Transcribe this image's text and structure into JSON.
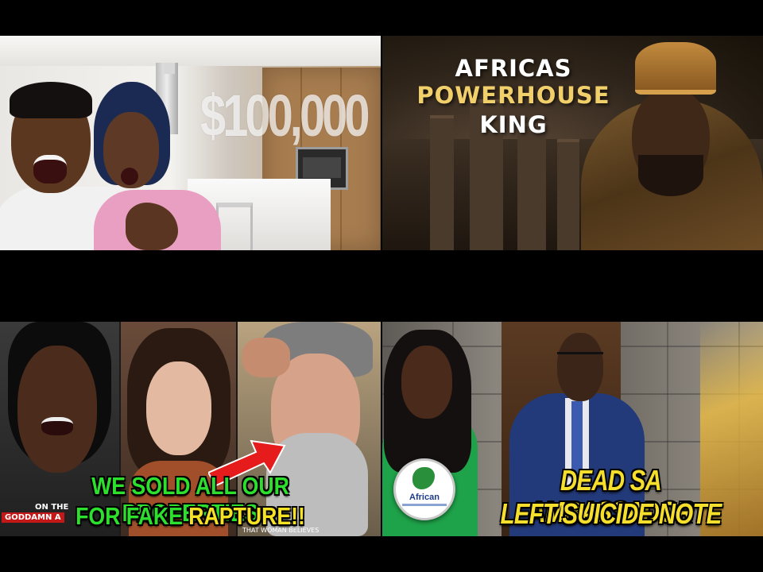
{
  "thumbnails": [
    {
      "topic": "kitchen",
      "overlay_text": "$100,000"
    },
    {
      "topic": "king",
      "title_lines": [
        "AFRICAS",
        "POWERHOUSE",
        "KING"
      ],
      "accent": "#f1cf6b"
    },
    {
      "topic": "rapture",
      "caption_line1": "WE SOLD ALL OUR PROPERTIES",
      "caption_line2_a": "FOR FAKE ",
      "caption_line2_b": "RAPTURE!!",
      "small_caption_1": "ON THE",
      "small_caption_2": "GODDAMN A",
      "small_caption_3": "THAT WOMAN BELIEVES",
      "caption_color": "#2ee02e",
      "highlight_color": "#f5e224"
    },
    {
      "topic": "ambassador",
      "headline_line1": "DEAD SA AMBASSADOR",
      "headline_line2": "LEFT SUICIDE NOTE",
      "badge_text": "African",
      "headline_color": "#f6df2c"
    }
  ]
}
